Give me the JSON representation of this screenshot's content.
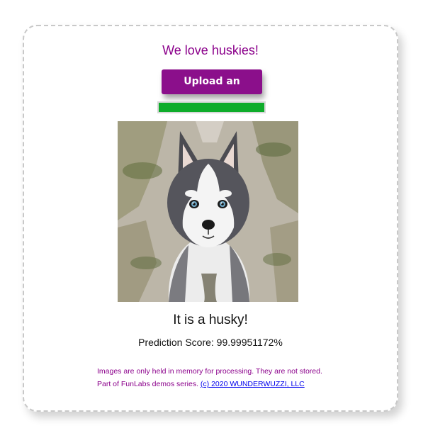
{
  "page": {
    "title": "We love huskies!",
    "upload_label": "Upload an image...",
    "upload_progress_percent": 100,
    "result_text": "It is a husky!",
    "prediction_score": "Prediction Score: 99.99951172%",
    "footer_line1": "Images are only held in memory for processing. They are not stored.",
    "footer_line2_prefix": "Part of FunLabs demos series. ",
    "footer_link": "(c) 2020 WUNDERWUZZI, LLC"
  },
  "colors": {
    "accent": "#8b008b",
    "button": "#8b0f8b",
    "progress": "#0eac2a",
    "link": "#0000ee"
  },
  "image": {
    "subject": "husky-puppy"
  }
}
